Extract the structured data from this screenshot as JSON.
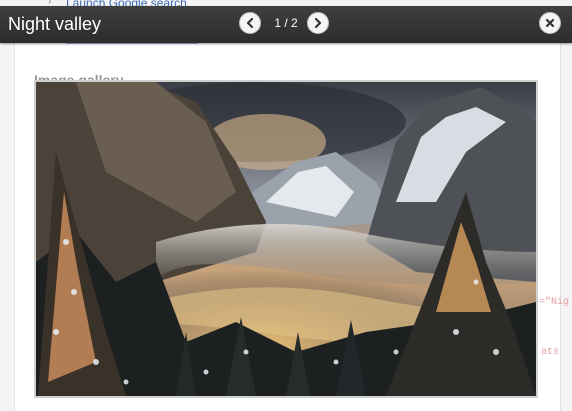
{
  "lightbox": {
    "title": "Night valley",
    "counter": "1 / 2"
  },
  "background_page": {
    "top_link": "Launch Google search",
    "heading": "Image gallery",
    "code_fragment_1": "=\"Nig",
    "code_fragment_2": "ats"
  },
  "icons": {
    "prev": "chevron-left-icon",
    "next": "chevron-right-icon",
    "close": "close-icon"
  },
  "colors": {
    "titlebar": "#333333",
    "button": "#f4f4f4"
  }
}
